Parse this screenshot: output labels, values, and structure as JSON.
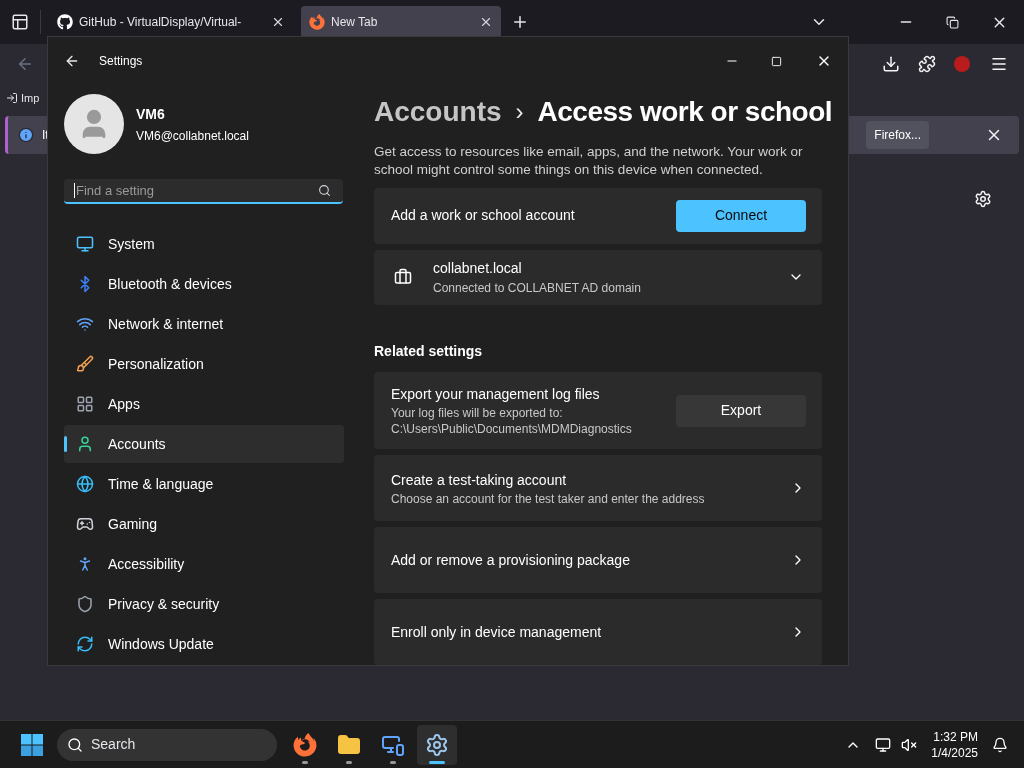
{
  "browser": {
    "tabs": [
      {
        "title": "GitHub - VirtualDisplay/Virtual-",
        "selected": false
      },
      {
        "title": "New Tab",
        "selected": true
      }
    ],
    "bookmark": "Imp",
    "notification": {
      "text": "It",
      "button": "Firefox..."
    }
  },
  "settings": {
    "title": "Settings",
    "user": {
      "name": "VM6",
      "email": "VM6@collabnet.local"
    },
    "search": {
      "placeholder": "Find a setting"
    },
    "nav": [
      {
        "label": "System",
        "selected": false
      },
      {
        "label": "Bluetooth & devices",
        "selected": false
      },
      {
        "label": "Network & internet",
        "selected": false
      },
      {
        "label": "Personalization",
        "selected": false
      },
      {
        "label": "Apps",
        "selected": false
      },
      {
        "label": "Accounts",
        "selected": true
      },
      {
        "label": "Time & language",
        "selected": false
      },
      {
        "label": "Gaming",
        "selected": false
      },
      {
        "label": "Accessibility",
        "selected": false
      },
      {
        "label": "Privacy & security",
        "selected": false
      },
      {
        "label": "Windows Update",
        "selected": false
      }
    ],
    "breadcrumb": {
      "parent": "Accounts",
      "separator": "›",
      "current": "Access work or school"
    },
    "description": "Get access to resources like email, apps, and the network. Your work or school might control some things on this device when connected.",
    "add_account": {
      "label": "Add a work or school account",
      "button": "Connect"
    },
    "connection": {
      "name": "collabnet.local",
      "detail": "Connected to COLLABNET AD domain",
      "expanded": false
    },
    "related": {
      "heading": "Related settings",
      "items": [
        {
          "kind": "button",
          "title": "Export your management log files",
          "subtitle": "Your log files will be exported to: C:\\Users\\Public\\Documents\\MDMDiagnostics",
          "button": "Export"
        },
        {
          "kind": "link",
          "title": "Create a test-taking account",
          "subtitle": "Choose an account for the test taker and enter the address"
        },
        {
          "kind": "link",
          "title": "Add or remove a provisioning package"
        },
        {
          "kind": "link",
          "title": "Enroll only in device management"
        }
      ]
    }
  },
  "taskbar": {
    "search": "Search",
    "apps": [
      {
        "selected": false
      },
      {
        "selected": false
      },
      {
        "selected": false
      },
      {
        "selected": true
      }
    ],
    "clock": {
      "time": "1:32 PM",
      "date": "1/4/2025"
    }
  }
}
